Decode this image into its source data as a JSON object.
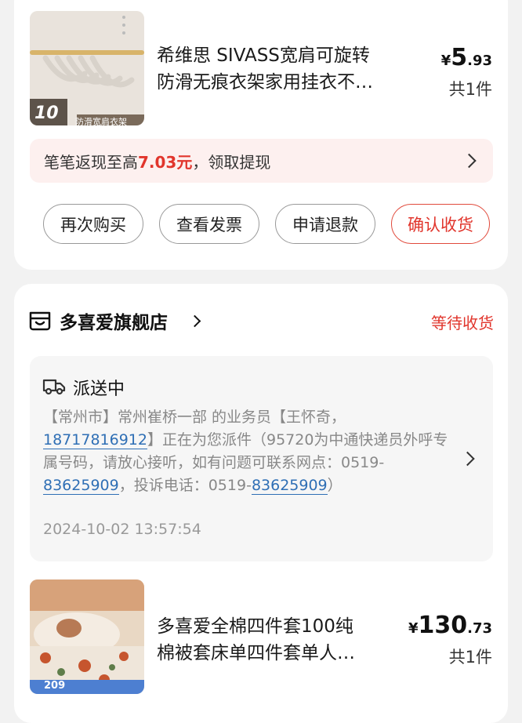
{
  "order1": {
    "product": {
      "title_line1": "希维思 SIVASS宽肩可旋转",
      "title_line2": "防滑无痕衣架家用挂衣不…",
      "price_currency": "¥",
      "price_int": "5",
      "price_dec": ".93",
      "quantity": "共1件",
      "thumb_count": "10",
      "thumb_tag": "防滑宽肩衣架"
    },
    "cashback": {
      "prefix": "笔笔返现至高",
      "amount": "7.03元",
      "suffix": "，领取提现"
    },
    "buttons": [
      "再次购买",
      "查看发票",
      "申请退款",
      "确认收货"
    ]
  },
  "order2": {
    "shop_name": "多喜爱旗舰店",
    "status": "等待收货",
    "delivery": {
      "title": "派送中",
      "text_part1": "【常州市】常州崔桥一部 的业务员【王怀奇，",
      "phone1": "18717816912",
      "text_part2": "】正在为您派件（95720为中通快递员外呼专属号码，请放心接听，如有问题可联系网点：0519-",
      "phone2": "83625909",
      "text_part3": "，投诉电话：0519-",
      "phone3": "83625909",
      "text_part4": "）",
      "time": "2024-10-02 13:57:54"
    },
    "product": {
      "title_line1": "多喜爱全棉四件套100纯",
      "title_line2": "棉被套床单四件套单人…",
      "price_currency": "¥",
      "price_int": "130",
      "price_dec": ".73",
      "quantity": "共1件",
      "thumb_price": "209"
    }
  },
  "colors": {
    "accent_red": "#e1352c",
    "link_blue": "#2f6fb5",
    "cashback_bg": "#fdf0ef"
  },
  "icons": [
    "chevron-right-icon",
    "shop-icon",
    "delivery-truck-icon"
  ]
}
